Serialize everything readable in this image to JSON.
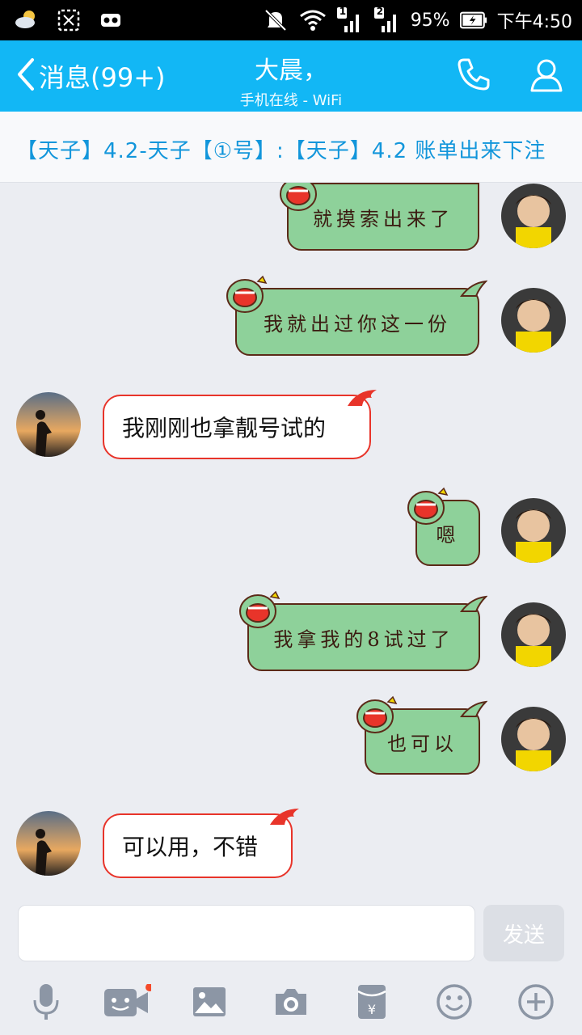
{
  "status_bar": {
    "battery_percent": "95%",
    "time": "下午4:50",
    "sim1": "1",
    "sim2": "2"
  },
  "header": {
    "back_label": "消息(99+)",
    "contact_name": "大晨，",
    "contact_status": "手机在线 - WiFi",
    "call_icon": "phone-icon",
    "profile_icon": "person-icon",
    "background_color": "#12b7f5"
  },
  "announcement": {
    "text": "【天子】4.2-天子【①号】:【天子】4.2 账单出来下注"
  },
  "messages": [
    {
      "side": "right",
      "text": "就摸索出来了"
    },
    {
      "side": "right",
      "text": "我就出过你这一份"
    },
    {
      "side": "left",
      "text": "我刚刚也拿靓号试的"
    },
    {
      "side": "right",
      "text": "嗯"
    },
    {
      "side": "right",
      "text": "我拿我的8试过了"
    },
    {
      "side": "right",
      "text": "也可以"
    },
    {
      "side": "left",
      "text": "可以用，不错"
    }
  ],
  "input": {
    "value": "",
    "send_label": "发送"
  },
  "toolbar": {
    "icons": [
      "microphone-icon",
      "video-call-icon",
      "image-icon",
      "camera-icon",
      "red-packet-icon",
      "emoji-icon",
      "plus-icon"
    ]
  },
  "colors": {
    "accent": "#12b7f5",
    "bubble_green": "#8ed19a",
    "bubble_red_border": "#e8342a",
    "link_blue": "#1296db"
  }
}
